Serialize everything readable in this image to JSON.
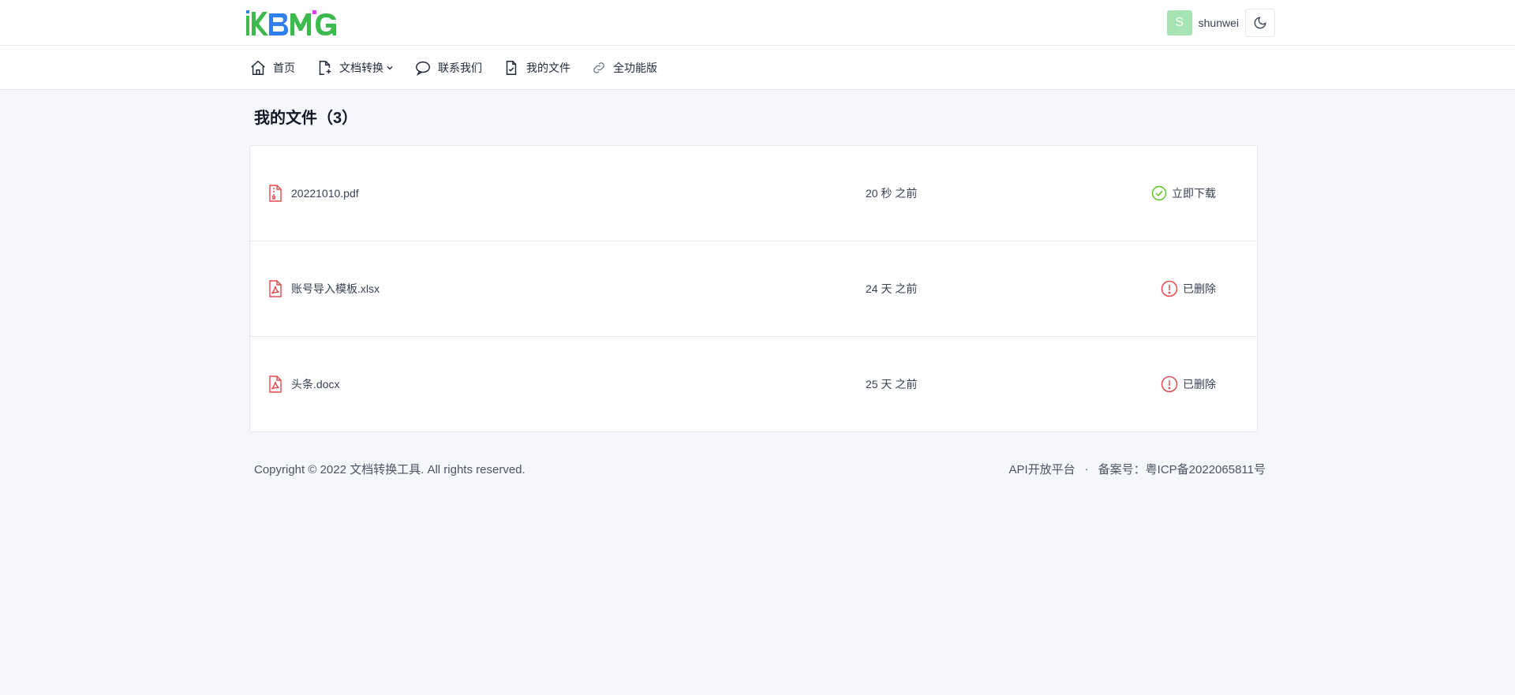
{
  "header": {
    "logo_text": "KBMG",
    "username": "shunwei",
    "avatar_letter": "S"
  },
  "nav": {
    "items": [
      {
        "label": "首页",
        "icon": "home-icon"
      },
      {
        "label": "文档转换",
        "icon": "file-convert-icon"
      },
      {
        "label": "联系我们",
        "icon": "chat-icon"
      },
      {
        "label": "我的文件",
        "icon": "file-check-icon"
      },
      {
        "label": "全功能版",
        "icon": "link-icon"
      }
    ]
  },
  "main": {
    "title": "我的文件（3）",
    "files": [
      {
        "name": "20221010.pdf",
        "time": "20 秒 之前",
        "status": "立即下载",
        "status_type": "ok"
      },
      {
        "name": "账号导入模板.xlsx",
        "time": "24 天 之前",
        "status": "已删除",
        "status_type": "deleted"
      },
      {
        "name": "头条.docx",
        "time": "25 天 之前",
        "status": "已删除",
        "status_type": "deleted"
      }
    ]
  },
  "footer": {
    "copyright": "Copyright © 2022 文档转换工具. All rights reserved.",
    "api_link": "API开放平台",
    "separator": "·",
    "icp": "备案号：粤ICP备2022065811号"
  },
  "colors": {
    "accent_green": "#4caf50",
    "logo_blue": "#2f80ed",
    "logo_green": "#3dba4e",
    "ok": "#52c41a",
    "danger": "#e5484d"
  }
}
